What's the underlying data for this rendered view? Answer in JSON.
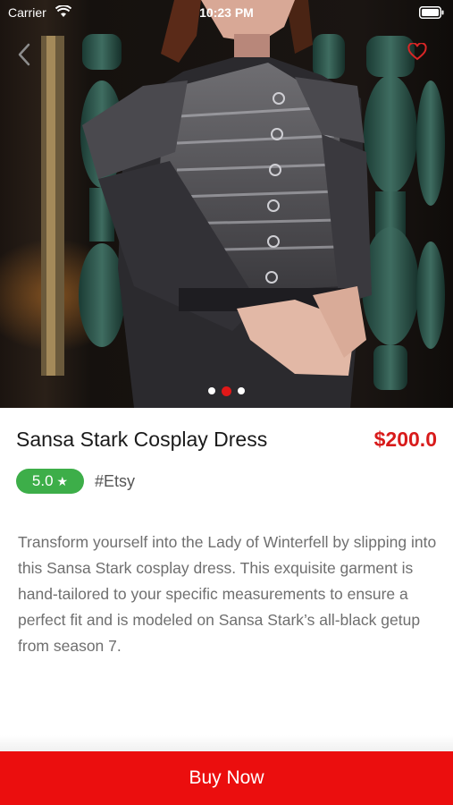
{
  "status_bar": {
    "carrier": "Carrier",
    "time": "10:23 PM"
  },
  "gallery": {
    "page_count": 3,
    "active_index": 1
  },
  "product": {
    "title": "Sansa Stark Cosplay Dress",
    "price": "$200.0",
    "rating": "5.0",
    "tag": "#Etsy",
    "description": "Transform yourself into the Lady of Winterfell by slipping into this Sansa Stark cosplay dress. This exquisite garment is hand-tailored to your specific measurements to ensure a perfect fit and is modeled on Sansa Stark’s all-black getup from season 7."
  },
  "actions": {
    "buy_label": "Buy Now"
  },
  "icons": [
    "wifi-icon",
    "battery-icon",
    "back-icon",
    "heart-icon",
    "star-icon"
  ],
  "colors": {
    "accent": "#eb0e0e",
    "price": "#d81b1b",
    "rating": "#3dae49"
  }
}
